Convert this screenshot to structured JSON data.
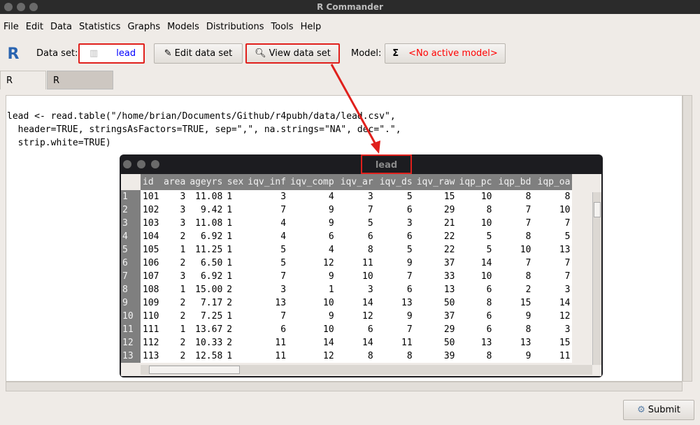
{
  "window": {
    "title": "R Commander"
  },
  "menu": [
    "File",
    "Edit",
    "Data",
    "Statistics",
    "Graphs",
    "Models",
    "Distributions",
    "Tools",
    "Help"
  ],
  "toolbar": {
    "dataset_label": "Data set:",
    "dataset_value": "lead",
    "edit_label": "Edit data set",
    "view_label": "View data set",
    "model_label": "Model:",
    "model_value": "<No active model>",
    "model_color": "#ff0000",
    "dataset_color": "#0000ff"
  },
  "tabs": [
    "R Script",
    "R Markdown"
  ],
  "script": [
    "lead <- read.table(\"/home/brian/Documents/Github/r4pubh/data/lead.csv\",",
    "  header=TRUE, stringsAsFactors=TRUE, sep=\",\", na.strings=\"NA\", dec=\".\",",
    "  strip.white=TRUE)"
  ],
  "viewer": {
    "title": "lead",
    "columns": [
      "id",
      "area",
      "ageyrs",
      "sex",
      "iqv_inf",
      "iqv_comp",
      "iqv_ar",
      "iqv_ds",
      "iqv_raw",
      "iqp_pc",
      "iqp_bd",
      "iqp_oa"
    ],
    "rows": [
      [
        "1",
        "101",
        "3",
        "11.08",
        "1",
        "3",
        "4",
        "3",
        "5",
        "15",
        "10",
        "8",
        "8"
      ],
      [
        "2",
        "102",
        "3",
        "9.42",
        "1",
        "7",
        "9",
        "7",
        "6",
        "29",
        "8",
        "7",
        "10"
      ],
      [
        "3",
        "103",
        "3",
        "11.08",
        "1",
        "4",
        "9",
        "5",
        "3",
        "21",
        "10",
        "7",
        "7"
      ],
      [
        "4",
        "104",
        "2",
        "6.92",
        "1",
        "4",
        "6",
        "6",
        "6",
        "22",
        "5",
        "8",
        "5"
      ],
      [
        "5",
        "105",
        "1",
        "11.25",
        "1",
        "5",
        "4",
        "8",
        "5",
        "22",
        "5",
        "10",
        "13"
      ],
      [
        "6",
        "106",
        "2",
        "6.50",
        "1",
        "5",
        "12",
        "11",
        "9",
        "37",
        "14",
        "7",
        "7"
      ],
      [
        "7",
        "107",
        "3",
        "6.92",
        "1",
        "7",
        "9",
        "10",
        "7",
        "33",
        "10",
        "8",
        "7"
      ],
      [
        "8",
        "108",
        "1",
        "15.00",
        "2",
        "3",
        "1",
        "3",
        "6",
        "13",
        "6",
        "2",
        "3"
      ],
      [
        "9",
        "109",
        "2",
        "7.17",
        "2",
        "13",
        "10",
        "14",
        "13",
        "50",
        "8",
        "15",
        "14"
      ],
      [
        "10",
        "110",
        "2",
        "7.25",
        "1",
        "7",
        "9",
        "12",
        "9",
        "37",
        "6",
        "9",
        "12"
      ],
      [
        "11",
        "111",
        "1",
        "13.67",
        "2",
        "6",
        "10",
        "6",
        "7",
        "29",
        "6",
        "8",
        "3"
      ],
      [
        "12",
        "112",
        "2",
        "10.33",
        "2",
        "11",
        "14",
        "14",
        "11",
        "50",
        "13",
        "13",
        "15"
      ],
      [
        "13",
        "113",
        "2",
        "12.58",
        "1",
        "11",
        "12",
        "8",
        "8",
        "39",
        "8",
        "9",
        "11"
      ]
    ]
  },
  "submit_label": "Submit"
}
